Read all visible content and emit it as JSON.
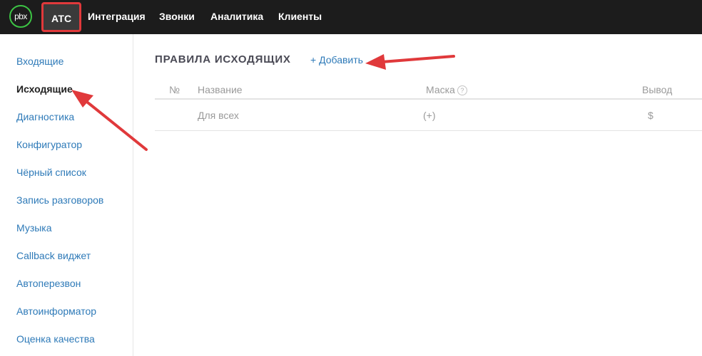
{
  "header": {
    "logo_text": "pbx",
    "nav": [
      {
        "label": "АТС"
      },
      {
        "label": "Интеграция"
      },
      {
        "label": "Звонки"
      },
      {
        "label": "Аналитика"
      },
      {
        "label": "Клиенты"
      }
    ]
  },
  "sidebar": {
    "items": [
      {
        "label": "Входящие"
      },
      {
        "label": "Исходящие"
      },
      {
        "label": "Диагностика"
      },
      {
        "label": "Конфигуратор"
      },
      {
        "label": "Чёрный список"
      },
      {
        "label": "Запись разговоров"
      },
      {
        "label": "Музыка"
      },
      {
        "label": "Callback виджет"
      },
      {
        "label": "Автоперезвон"
      },
      {
        "label": "Автоинформатор"
      },
      {
        "label": "Оценка качества"
      }
    ],
    "active_item": "Исходящие"
  },
  "main": {
    "title": "ПРАВИЛА ИСХОДЯЩИХ",
    "add_label": "+ Добавить",
    "table": {
      "columns": [
        "№",
        "Название",
        "Маска",
        "Вывод"
      ],
      "rows": [
        {
          "number": "",
          "name": "Для всех",
          "mask": "(+)",
          "output": "$"
        }
      ]
    }
  },
  "colors": {
    "topbar_bg": "#1c1c1c",
    "accent_link": "#2e7ab8",
    "logo_ring": "#3cc444",
    "annotation_red": "#e0393b"
  }
}
